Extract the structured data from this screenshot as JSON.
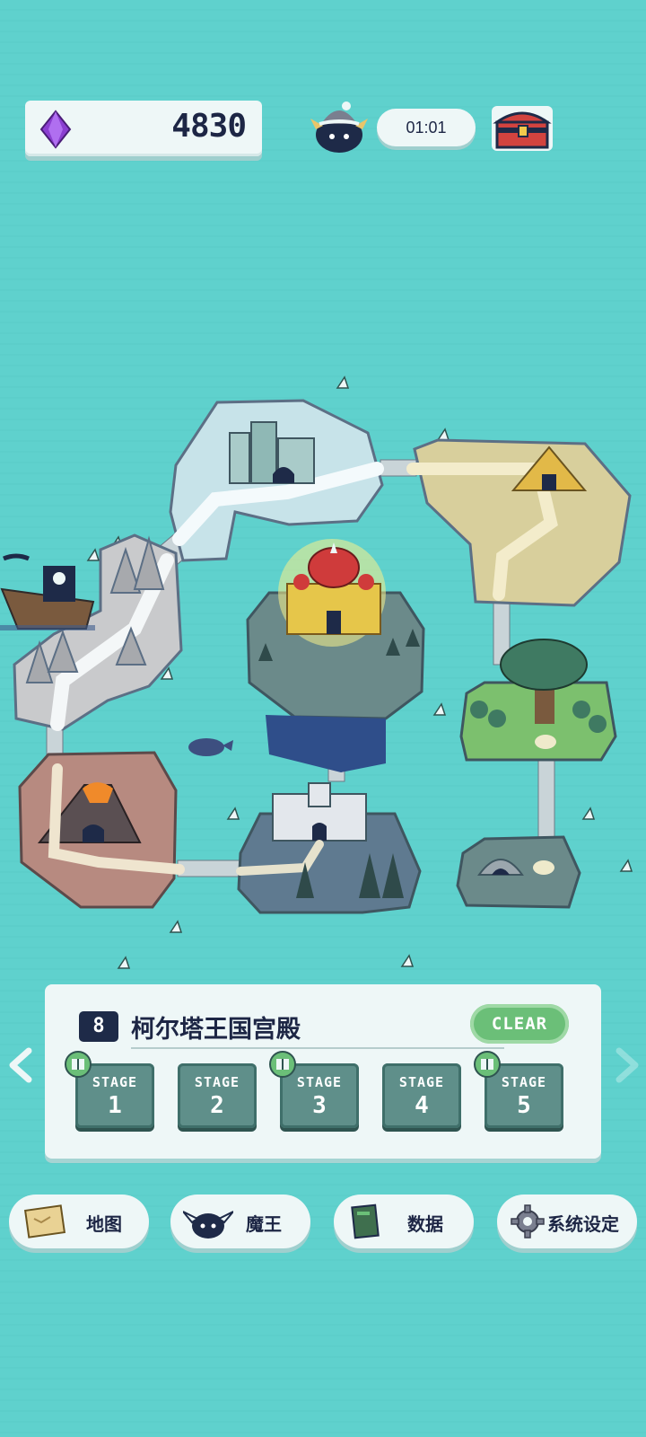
{
  "top_bar": {
    "gem_count": "4830",
    "timer": "01:01",
    "colors": {
      "gem": "#8b3fd1",
      "panel": "#eef7f7",
      "chest": "#d2433f"
    }
  },
  "map": {
    "current_area": "castle-palace",
    "areas": [
      "snow-mountain",
      "desert-pyramid",
      "rocky-peaks",
      "pirate-ship",
      "royal-palace",
      "forest-tree",
      "volcano",
      "stone-castle",
      "cave"
    ]
  },
  "stage_panel": {
    "area_number": "8",
    "area_name": "柯尔塔王国宫殿",
    "clear_label": "CLEAR",
    "stages": [
      {
        "label": "STAGE",
        "number": "1",
        "has_book": true
      },
      {
        "label": "STAGE",
        "number": "2",
        "has_book": false
      },
      {
        "label": "STAGE",
        "number": "3",
        "has_book": true
      },
      {
        "label": "STAGE",
        "number": "4",
        "has_book": false
      },
      {
        "label": "STAGE",
        "number": "5",
        "has_book": true
      }
    ]
  },
  "bottom_nav": {
    "map_label": "地图",
    "demon_label": "魔王",
    "data_label": "数据",
    "settings_label": "系统设定"
  }
}
